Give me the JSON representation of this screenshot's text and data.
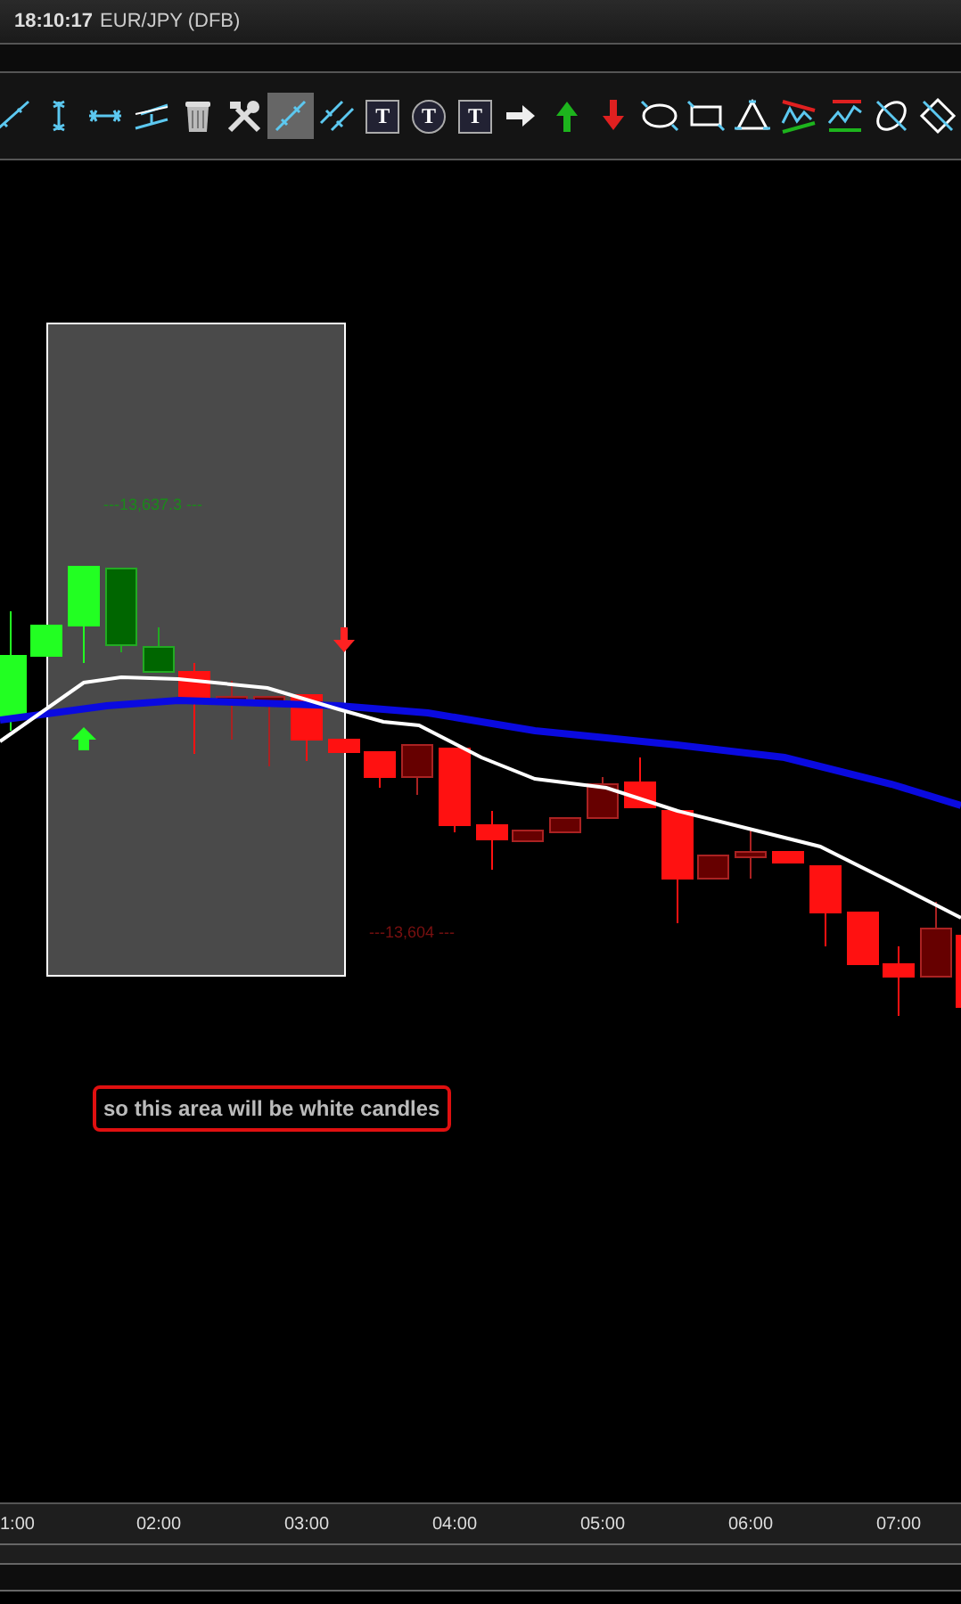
{
  "window": {
    "time": "18:10:17",
    "title": "EUR/JPY (DFB)"
  },
  "toolbar": [
    {
      "kind": "trend-line",
      "selected": false
    },
    {
      "kind": "vertical-line",
      "selected": false
    },
    {
      "kind": "horizontal-line",
      "selected": false
    },
    {
      "kind": "channel",
      "selected": false
    },
    {
      "kind": "trash",
      "selected": false
    },
    {
      "kind": "tools",
      "selected": false
    },
    {
      "kind": "ray",
      "selected": true
    },
    {
      "kind": "parallel",
      "selected": false
    },
    {
      "kind": "text-anchor",
      "label": "T",
      "selected": false
    },
    {
      "kind": "text-bubble",
      "label": "T",
      "selected": false
    },
    {
      "kind": "text-note",
      "label": "T",
      "selected": false
    },
    {
      "kind": "arrow-right",
      "selected": false
    },
    {
      "kind": "arrow-up",
      "selected": false
    },
    {
      "kind": "arrow-down",
      "selected": false
    },
    {
      "kind": "ellipse",
      "selected": false
    },
    {
      "kind": "rectangle",
      "selected": false
    },
    {
      "kind": "triangle",
      "selected": false
    },
    {
      "kind": "wedge",
      "selected": false
    },
    {
      "kind": "levels",
      "selected": false
    },
    {
      "kind": "ellipse-diag",
      "selected": false
    },
    {
      "kind": "diamond",
      "selected": false
    }
  ],
  "chart": {
    "kind": "picture",
    "high_label": "---13,637.3 ---",
    "low_label": "---13,604 ---",
    "note": "so this area will be white candles"
  },
  "time_axis": [
    "1:00",
    "02:00",
    "03:00",
    "04:00",
    "05:00",
    "06:00",
    "07:00"
  ]
}
